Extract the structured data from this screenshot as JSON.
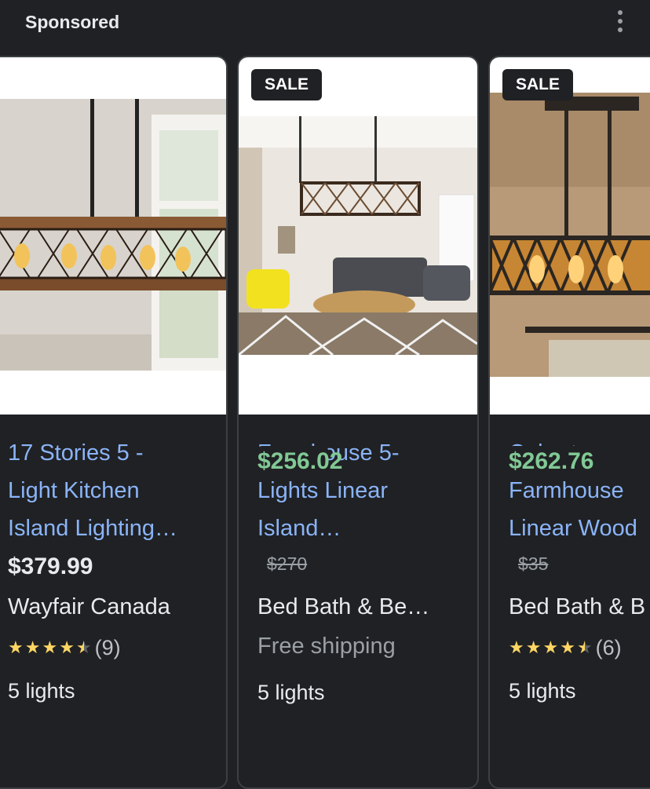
{
  "header": {
    "label": "Sponsored",
    "menu_icon": "more-vert-icon"
  },
  "colors": {
    "link": "#8ab4f8",
    "sale_price": "#81c995",
    "star": "#fdd663",
    "background": "#202124"
  },
  "products": [
    {
      "title_lines": [
        "17 Stories 5 -",
        "Light Kitchen",
        "Island Lighting…"
      ],
      "price": "$379.99",
      "merchant": "Wayfair Canada",
      "rating": 4.5,
      "review_count": "(9)",
      "detail": "5 lights",
      "image": "wood-chandelier-photo"
    },
    {
      "sale_badge": "SALE",
      "title_lines": [
        "Farmhouse 5-",
        "Lights Linear",
        "Island…"
      ],
      "price": "$256.02",
      "old_price": "$270",
      "merchant": "Bed Bath & Be…",
      "shipping": "Free shipping",
      "detail": "5 lights",
      "image": "living-room-chandelier-photo"
    },
    {
      "sale_badge": "SALE",
      "title_lines": [
        "Cobert",
        "Farmhouse",
        "Linear Wood"
      ],
      "price": "$262.76",
      "old_price": "$35",
      "merchant": "Bed Bath & B",
      "rating": 4.5,
      "review_count": "(6)",
      "detail": "5 lights",
      "image": "dark-chandelier-photo"
    }
  ]
}
